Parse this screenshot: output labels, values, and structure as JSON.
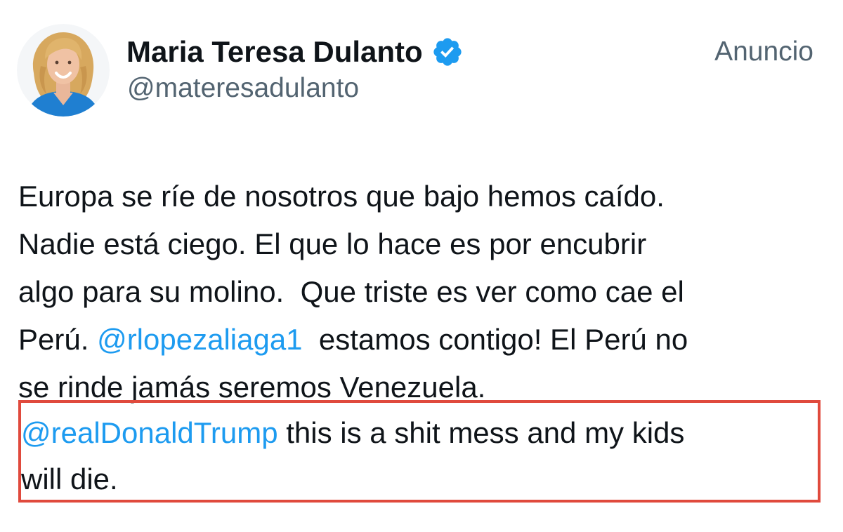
{
  "author": {
    "display_name": "Maria Teresa Dulanto",
    "handle": "@materesadulanto",
    "verified_icon": "verified-badge-icon",
    "avatar": "profile-photo"
  },
  "ad_label": "Anuncio",
  "tweet": {
    "line1": "Europa se ríe de nosotros que bajo hemos caído.",
    "line2": "Nadie está ciego. El que lo hace es por encubrir",
    "line3": "algo para su molino.  Que triste es ver como cae el",
    "line4_prefix": "Perú. ",
    "mention1": "@rlopezaliaga1",
    "line4_suffix": "  estamos contigo! El Perú no",
    "line5": "se rinde jamás seremos Venezuela.",
    "mention2": "@realDonaldTrump",
    "line6_suffix": " this is a shit mess and my kids",
    "line7": "will die."
  },
  "colors": {
    "mention": "#1d9bf0",
    "highlight_border": "#e04a3d",
    "secondary_text": "#536471",
    "primary_text": "#0f1419"
  }
}
